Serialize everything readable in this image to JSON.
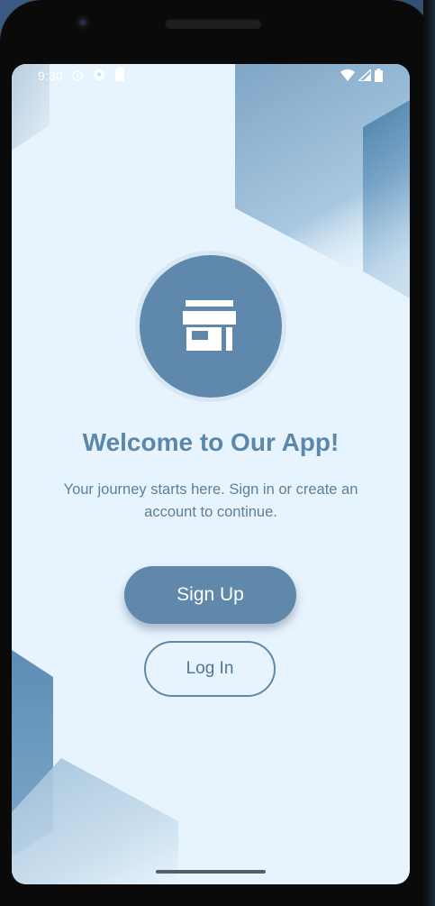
{
  "status_bar": {
    "time": "9:30",
    "left_icons": [
      "alarm-icon",
      "shield-icon",
      "sim-card-icon"
    ],
    "right_icons": [
      "wifi-icon",
      "cell-signal-icon",
      "battery-icon"
    ]
  },
  "logo": {
    "icon": "storefront-icon"
  },
  "welcome": {
    "title": "Welcome to Our App!",
    "subtitle_line1": "Your journey starts here. Sign in or create an",
    "subtitle_line2": "account to continue."
  },
  "actions": {
    "signup_label": "Sign Up",
    "login_label": "Log In"
  },
  "colors": {
    "background": "#e8f4fd",
    "primary": "#5f88aa",
    "title": "#5b87ab",
    "subtitle": "#5e7f98"
  }
}
